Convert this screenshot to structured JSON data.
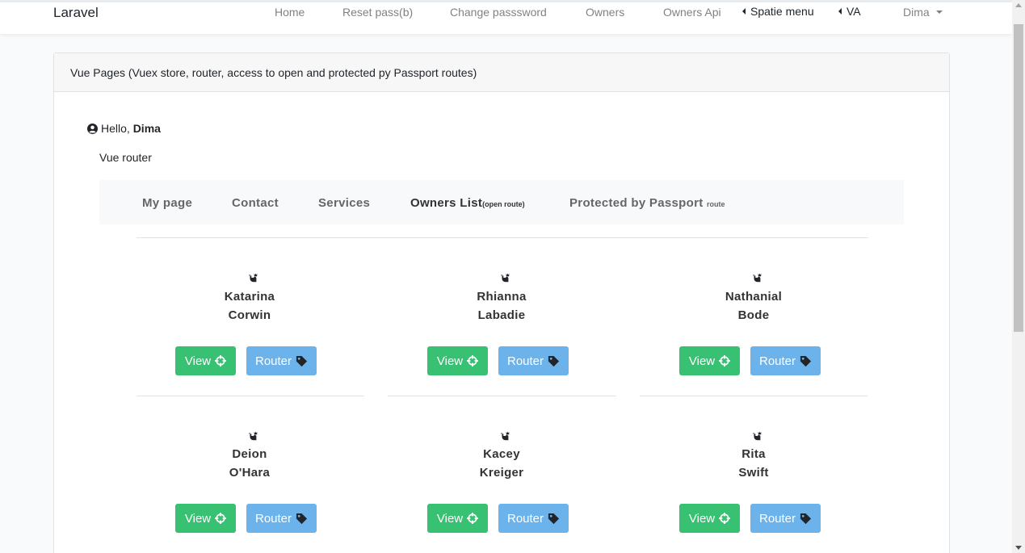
{
  "navbar": {
    "brand": "Laravel",
    "items": [
      {
        "label": "Home"
      },
      {
        "label": "Reset pass(b)"
      },
      {
        "label": "Change passsword"
      },
      {
        "label": "Owners"
      },
      {
        "label": "Owners Api"
      },
      {
        "label": "Spatie menu"
      },
      {
        "label": "VA"
      },
      {
        "label": "Dima"
      }
    ]
  },
  "card": {
    "header": "Vue Pages (Vuex store, router, access to open and protected py Passport routes)",
    "hello_prefix": "Hello,",
    "hello_user": "Dima",
    "section_label": "Vue router",
    "tabs": [
      {
        "label": "My page"
      },
      {
        "label": "Contact"
      },
      {
        "label": "Services"
      },
      {
        "label": "Owners List",
        "suffix": "(open route)"
      },
      {
        "label": "Protected by Passport",
        "suffix": "route"
      }
    ]
  },
  "owners": [
    {
      "first": "Katarina",
      "last": "Corwin"
    },
    {
      "first": "Rhianna",
      "last": "Labadie"
    },
    {
      "first": "Nathanial",
      "last": "Bode"
    },
    {
      "first": "Deion",
      "last": "O'Hara"
    },
    {
      "first": "Kacey",
      "last": "Kreiger"
    },
    {
      "first": "Rita",
      "last": "Swift"
    }
  ],
  "buttons": {
    "view_label": "View",
    "router_label": "Router"
  },
  "colors": {
    "view_button": "#38c172",
    "router_button": "#6cb2eb"
  }
}
